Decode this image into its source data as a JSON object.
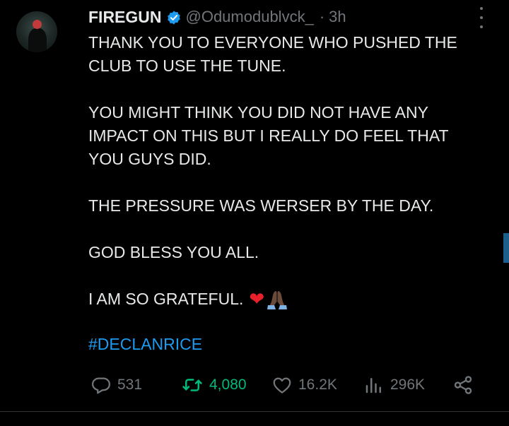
{
  "tweet": {
    "author_name": "FIREGUN",
    "handle": "@Odumodublvck_",
    "separator": "·",
    "time": "3h",
    "paragraphs": [
      "THANK YOU TO EVERYONE WHO PUSHED THE CLUB TO USE THE TUNE.",
      "YOU MIGHT THINK YOU DID NOT HAVE ANY IMPACT ON THIS BUT I REALLY DO FEEL THAT YOU GUYS DID.",
      "THE PRESSURE WAS WERSER BY THE DAY.",
      "GOD BLESS YOU ALL."
    ],
    "closing_line": "I AM SO GRATEFUL.",
    "emoji_heart": "❤",
    "hashtag": "#DECLANRICE"
  },
  "actions": {
    "replies": "531",
    "retweets": "4,080",
    "likes": "16.2K",
    "views": "296K"
  },
  "icons": {
    "verified": "verified-badge-icon",
    "more": "more-options-icon",
    "reply": "reply-icon",
    "retweet": "retweet-icon",
    "like": "heart-icon",
    "views": "views-icon",
    "share": "share-icon"
  },
  "colors": {
    "background": "#000000",
    "text": "#e7e9ea",
    "muted": "#71767b",
    "link": "#1d9bf0",
    "retweet_active": "#00ba7c",
    "heart_emoji": "#e8202a"
  }
}
